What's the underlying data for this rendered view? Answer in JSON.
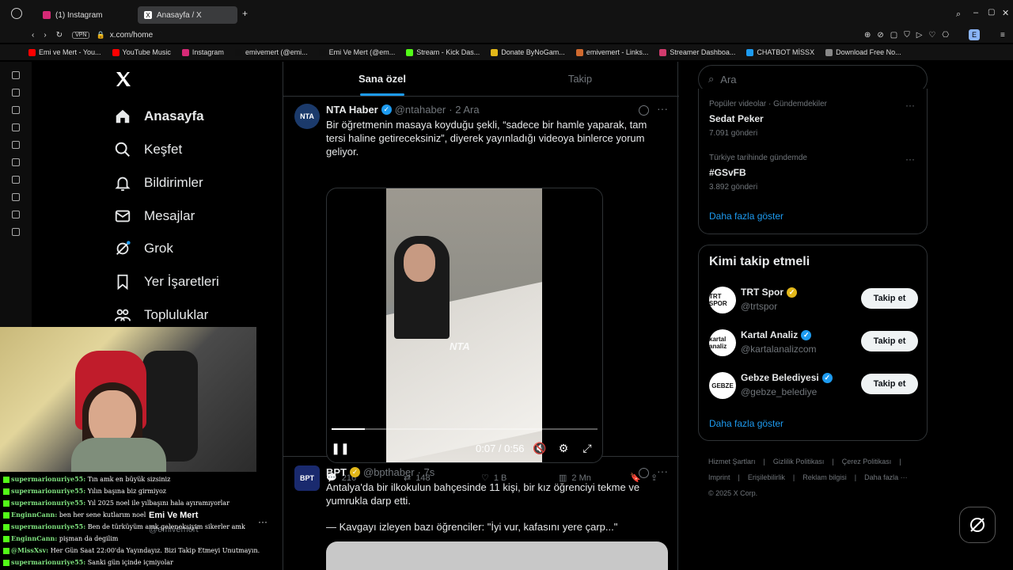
{
  "browser": {
    "tabs": [
      {
        "label": "(1) Instagram",
        "active": false
      },
      {
        "label": "Anasayfa / X",
        "active": true
      }
    ],
    "vpn_label": "VPN",
    "url": "x.com/home",
    "bookmarks": [
      {
        "label": "Emi ve Mert - You...",
        "color": "#ff0000"
      },
      {
        "label": "YouTube Music",
        "color": "#ff0000"
      },
      {
        "label": "Instagram",
        "color": "#d62976"
      },
      {
        "label": "emivemert (@emi...",
        "color": "#111111"
      },
      {
        "label": "Emi Ve Mert (@em...",
        "color": "#111111"
      },
      {
        "label": "Stream - Kick Das...",
        "color": "#53fc18"
      },
      {
        "label": "Donate ByNoGam...",
        "color": "#e2b719"
      },
      {
        "label": "emivemert - Links...",
        "color": "#d06a2f"
      },
      {
        "label": "Streamer Dashboa...",
        "color": "#d13b6d"
      },
      {
        "label": "CHATBOT MİSSX",
        "color": "#1d9bf0"
      },
      {
        "label": "Download Free No...",
        "color": "#888888"
      }
    ]
  },
  "nav": {
    "items": [
      {
        "label": "Anasayfa",
        "icon": "home-icon",
        "bold": true
      },
      {
        "label": "Keşfet",
        "icon": "search-icon",
        "bold": false
      },
      {
        "label": "Bildirimler",
        "icon": "bell-icon",
        "bold": false
      },
      {
        "label": "Mesajlar",
        "icon": "mail-icon",
        "bold": false
      },
      {
        "label": "Grok",
        "icon": "grok-icon",
        "bold": false
      },
      {
        "label": "Yer İşaretleri",
        "icon": "bookmark-icon",
        "bold": false
      },
      {
        "label": "Topluluklar",
        "icon": "communities-icon",
        "bold": false
      }
    ]
  },
  "feed": {
    "tabs": [
      "Sana özel",
      "Takip"
    ],
    "tweets": [
      {
        "avatar": "NTA",
        "name": "NTA Haber",
        "handle": "@ntahaber",
        "time": "· 2 Ara",
        "text": "Bir öğretmenin masaya koyduğu şekli, “sadece bir hamle yaparak, tam tersi haline getireceksiniz”, diyerek yayınladığı videoya binlerce yorum geliyor.",
        "video": {
          "watermark": "NTA",
          "time": "0:07 / 0:56",
          "progress": 0.125
        },
        "actions": {
          "replies": "216",
          "reposts": "148",
          "likes": "1 B",
          "views": "2 Mn"
        }
      },
      {
        "avatar": "BPT",
        "name": "BPT",
        "handle": "@bpthaber",
        "time": "· 7s",
        "text": "Antalya'da bir ilkokulun bahçesinde 11 kişi, bir kız öğrenciyi tekme ve yumrukla darp etti.",
        "text2": "— Kavgayı izleyen bazı öğrenciler: \"İyi vur, kafasını yere çarp...\""
      }
    ]
  },
  "right": {
    "search_placeholder": "Ara",
    "trends": [
      {
        "meta": "Popüler videolar · Gündemdekiler",
        "topic": "Sedat Peker",
        "posts": "7.091 gönderi"
      },
      {
        "meta": "Türkiye tarihinde gündemde",
        "topic": "#GSvFB",
        "posts": "3.892 gönderi"
      }
    ],
    "show_more": "Daha fazla göster",
    "who_title": "Kimi takip etmeli",
    "who": [
      {
        "name": "TRT Spor",
        "handle": "@trtspor",
        "avatar": "TRT SPOR",
        "badge": "gold"
      },
      {
        "name": "Kartal Analiz",
        "handle": "@kartalanalizcom",
        "avatar": "kartal analiz",
        "badge": "blue"
      },
      {
        "name": "Gebze Belediyesi",
        "handle": "@gebze_belediye",
        "avatar": "GEBZE",
        "badge": "blue"
      }
    ],
    "follow_label": "Takip et",
    "show_more_2": "Daha fazla göster",
    "footer": [
      "Hizmet Şartları",
      "|",
      "Gizlilik Politikası",
      "|",
      "Çerez Politikası",
      "|",
      "Imprint",
      "|",
      "Erişilebilirlik",
      "|",
      "Reklam bilgisi",
      "|",
      "Daha fazla ···",
      "© 2025 X Corp."
    ]
  },
  "stream": {
    "account_name": "Emi Ve Mert",
    "account_handle": "@emivemert",
    "chat": [
      {
        "user": "supermarionuriye55:",
        "msg": " Tın amk en büyük sizsiniz"
      },
      {
        "user": "supermarionuriye55:",
        "msg": " Yılın başına biz girmiyoz"
      },
      {
        "user": "supermarionuriye55:",
        "msg": " Yıl 2025 noel ile yılbaşını hala ayıramıyorlar"
      },
      {
        "user": "EnginnCann:",
        "msg": " ben her sene kutlarım noel"
      },
      {
        "user": "supermarionuriye55:",
        "msg": " Ben de türküyüm amk geleneksiyim sikerler amk"
      },
      {
        "user": "EnginnCann:",
        "msg": " pişman da degilim"
      },
      {
        "user": "@MissXsv:",
        "msg": " Her Gün Saat 22:00'da Yayındayız. Bizi Takip Etmeyi Unutmayın."
      },
      {
        "user": "supermarionuriye55:",
        "msg": " Sanki gün içinde içmiyolar"
      }
    ]
  }
}
